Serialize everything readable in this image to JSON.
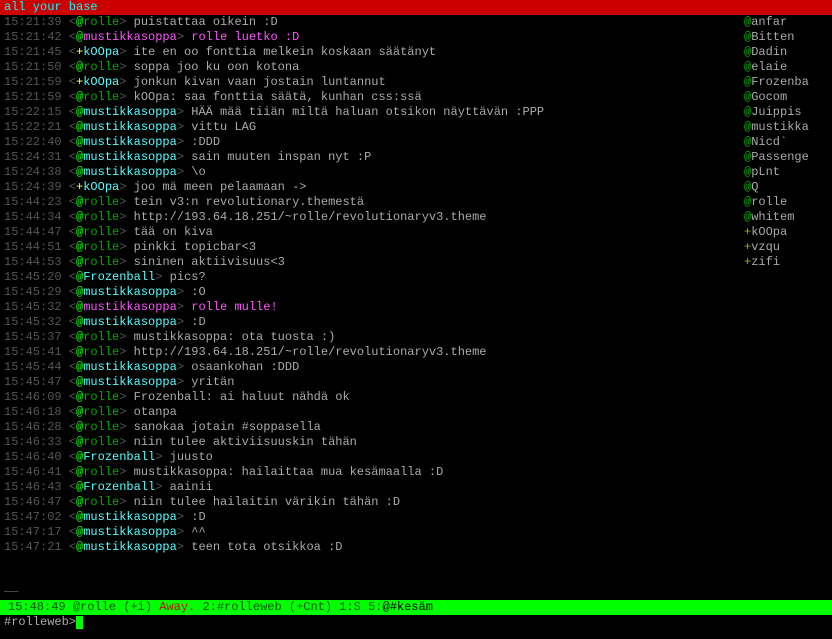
{
  "topic": "all your base",
  "lines": [
    {
      "ts": "15:21:39",
      "p": "@",
      "pc": "at",
      "nick": "rolle",
      "nc": "green",
      "msg": "puistattaa oikein :D",
      "mc": "msg"
    },
    {
      "ts": "15:21:42",
      "p": "@",
      "pc": "at",
      "nick": "mustikkasoppa",
      "nc": "mag",
      "msg": "rolle luetko :D",
      "mc": "msg-mag"
    },
    {
      "ts": "15:21:45",
      "p": "+",
      "pc": "plus",
      "nick": "kOOpa",
      "nc": "cyan",
      "msg": "ite en oo fonttia melkein koskaan säätänyt",
      "mc": "msg"
    },
    {
      "ts": "15:21:50",
      "p": "@",
      "pc": "at",
      "nick": "rolle",
      "nc": "green",
      "msg": "soppa joo ku oon kotona",
      "mc": "msg"
    },
    {
      "ts": "15:21:59",
      "p": "+",
      "pc": "plus",
      "nick": "kOOpa",
      "nc": "cyan",
      "msg": "jonkun kivan vaan jostain luntannut",
      "mc": "msg"
    },
    {
      "ts": "15:21:59",
      "p": "@",
      "pc": "at",
      "nick": "rolle",
      "nc": "green",
      "msg": "kOOpa: saa fonttia säätä, kunhan css:ssä",
      "mc": "msg"
    },
    {
      "ts": "15:22:15",
      "p": "@",
      "pc": "at",
      "nick": "mustikkasoppa",
      "nc": "cyan",
      "msg": "HÄÄ mää tiiän miltä haluan otsikon näyttävän :PPP",
      "mc": "msg"
    },
    {
      "ts": "15:22:21",
      "p": "@",
      "pc": "at",
      "nick": "mustikkasoppa",
      "nc": "cyan",
      "msg": "vittu LAG",
      "mc": "msg"
    },
    {
      "ts": "15:22:40",
      "p": "@",
      "pc": "at",
      "nick": "mustikkasoppa",
      "nc": "cyan",
      "msg": ":DDD",
      "mc": "msg"
    },
    {
      "ts": "15:24:31",
      "p": "@",
      "pc": "at",
      "nick": "mustikkasoppa",
      "nc": "cyan",
      "msg": "sain muuten inspan nyt :P",
      "mc": "msg"
    },
    {
      "ts": "15:24:38",
      "p": "@",
      "pc": "at",
      "nick": "mustikkasoppa",
      "nc": "cyan",
      "msg": "\\o",
      "mc": "msg"
    },
    {
      "ts": "15:24:39",
      "p": "+",
      "pc": "plus",
      "nick": "kOOpa",
      "nc": "cyan",
      "msg": "joo mä meen pelaamaan ->",
      "mc": "msg"
    },
    {
      "ts": "15:44:23",
      "p": "@",
      "pc": "at",
      "nick": "rolle",
      "nc": "green",
      "msg": "tein v3:n revolutionary.themestä",
      "mc": "msg"
    },
    {
      "ts": "15:44:34",
      "p": "@",
      "pc": "at",
      "nick": "rolle",
      "nc": "green",
      "msg": "http://193.64.18.251/~rolle/revolutionaryv3.theme",
      "mc": "msg"
    },
    {
      "ts": "15:44:47",
      "p": "@",
      "pc": "at",
      "nick": "rolle",
      "nc": "green",
      "msg": "tää on kiva",
      "mc": "msg"
    },
    {
      "ts": "15:44:51",
      "p": "@",
      "pc": "at",
      "nick": "rolle",
      "nc": "green",
      "msg": "pinkki topicbar<3",
      "mc": "msg"
    },
    {
      "ts": "15:44:53",
      "p": "@",
      "pc": "at",
      "nick": "rolle",
      "nc": "green",
      "msg": "sininen aktiivisuus<3",
      "mc": "msg"
    },
    {
      "ts": "15:45:20",
      "p": "@",
      "pc": "at",
      "nick": "Frozenball",
      "nc": "cyan",
      "msg": "pics?",
      "mc": "msg"
    },
    {
      "ts": "15:45:29",
      "p": "@",
      "pc": "at",
      "nick": "mustikkasoppa",
      "nc": "cyan",
      "msg": ":O",
      "mc": "msg"
    },
    {
      "ts": "15:45:32",
      "p": "@",
      "pc": "at",
      "nick": "mustikkasoppa",
      "nc": "mag",
      "msg": "rolle mulle!",
      "mc": "msg-mag"
    },
    {
      "ts": "15:45:32",
      "p": "@",
      "pc": "at",
      "nick": "mustikkasoppa",
      "nc": "cyan",
      "msg": ":D",
      "mc": "msg"
    },
    {
      "ts": "15:45:37",
      "p": "@",
      "pc": "at",
      "nick": "rolle",
      "nc": "green",
      "msg": "mustikkasoppa: ota tuosta :)",
      "mc": "msg"
    },
    {
      "ts": "15:45:41",
      "p": "@",
      "pc": "at",
      "nick": "rolle",
      "nc": "green",
      "msg": "http://193.64.18.251/~rolle/revolutionaryv3.theme",
      "mc": "msg"
    },
    {
      "ts": "15:45:44",
      "p": "@",
      "pc": "at",
      "nick": "mustikkasoppa",
      "nc": "cyan",
      "msg": "osaankohan  :DDD",
      "mc": "msg"
    },
    {
      "ts": "15:45:47",
      "p": "@",
      "pc": "at",
      "nick": "mustikkasoppa",
      "nc": "cyan",
      "msg": "yritän",
      "mc": "msg"
    },
    {
      "ts": "15:46:09",
      "p": "@",
      "pc": "at",
      "nick": "rolle",
      "nc": "green",
      "msg": "Frozenball: ai haluut nähdä ok",
      "mc": "msg"
    },
    {
      "ts": "15:46:18",
      "p": "@",
      "pc": "at",
      "nick": "rolle",
      "nc": "green",
      "msg": "otanpa",
      "mc": "msg"
    },
    {
      "ts": "15:46:28",
      "p": "@",
      "pc": "at",
      "nick": "rolle",
      "nc": "green",
      "msg": "sanokaa jotain #soppasella",
      "mc": "msg"
    },
    {
      "ts": "15:46:33",
      "p": "@",
      "pc": "at",
      "nick": "rolle",
      "nc": "green",
      "msg": "niin tulee aktiviisuuskin tähän",
      "mc": "msg"
    },
    {
      "ts": "15:46:40",
      "p": "@",
      "pc": "at",
      "nick": "Frozenball",
      "nc": "cyan",
      "msg": "juusto",
      "mc": "msg"
    },
    {
      "ts": "15:46:41",
      "p": "@",
      "pc": "at",
      "nick": "rolle",
      "nc": "green",
      "msg": "mustikkasoppa: hailaittaa mua kesämaalla :D",
      "mc": "msg"
    },
    {
      "ts": "15:46:43",
      "p": "@",
      "pc": "at",
      "nick": "Frozenball",
      "nc": "cyan",
      "msg": "aainii",
      "mc": "msg"
    },
    {
      "ts": "15:46:47",
      "p": "@",
      "pc": "at",
      "nick": "rolle",
      "nc": "green",
      "msg": "niin tulee hailaitin värikin tähän :D",
      "mc": "msg"
    },
    {
      "ts": "15:47:02",
      "p": "@",
      "pc": "at",
      "nick": "mustikkasoppa",
      "nc": "cyan",
      "msg": ":D",
      "mc": "msg"
    },
    {
      "ts": "15:47:17",
      "p": "@",
      "pc": "at",
      "nick": "mustikkasoppa",
      "nc": "cyan",
      "msg": "^^",
      "mc": "msg"
    },
    {
      "ts": "15:47:21",
      "p": "@",
      "pc": "at",
      "nick": "mustikkasoppa",
      "nc": "cyan",
      "msg": "teen tota otsikkoa :D",
      "mc": "msg"
    }
  ],
  "nicklist": [
    {
      "p": "@",
      "pc": "at",
      "name": "anfar"
    },
    {
      "p": "@",
      "pc": "at",
      "name": "Bitten"
    },
    {
      "p": "@",
      "pc": "at",
      "name": "Dadin"
    },
    {
      "p": "@",
      "pc": "at",
      "name": "elaie"
    },
    {
      "p": "@",
      "pc": "at",
      "name": "Frozenba"
    },
    {
      "p": "@",
      "pc": "at",
      "name": "Gocom"
    },
    {
      "p": "@",
      "pc": "at",
      "name": "Juippis"
    },
    {
      "p": "@",
      "pc": "at",
      "name": "mustikka"
    },
    {
      "p": "@",
      "pc": "at",
      "name": "Nicd`"
    },
    {
      "p": "@",
      "pc": "at",
      "name": "Passenge"
    },
    {
      "p": "@",
      "pc": "at",
      "name": "pLnt"
    },
    {
      "p": "@",
      "pc": "at",
      "name": "Q"
    },
    {
      "p": "@",
      "pc": "at",
      "name": "rolle"
    },
    {
      "p": "@",
      "pc": "at",
      "name": "whitem"
    },
    {
      "p": "+",
      "pc": "plus",
      "name": "kOOpa"
    },
    {
      "p": "+",
      "pc": "plus",
      "name": "vzqu"
    },
    {
      "p": "+",
      "pc": "plus",
      "name": "zifi"
    }
  ],
  "statusbar": {
    "time": "15:48:49",
    "nick": "@rolle (+i)",
    "away": "Away.",
    "win": "2:#rolleweb (+Cnt)  1:S",
    "act": "5:",
    "actchan": "@#kesäm"
  },
  "input": {
    "prompt": "#rolleweb>"
  }
}
